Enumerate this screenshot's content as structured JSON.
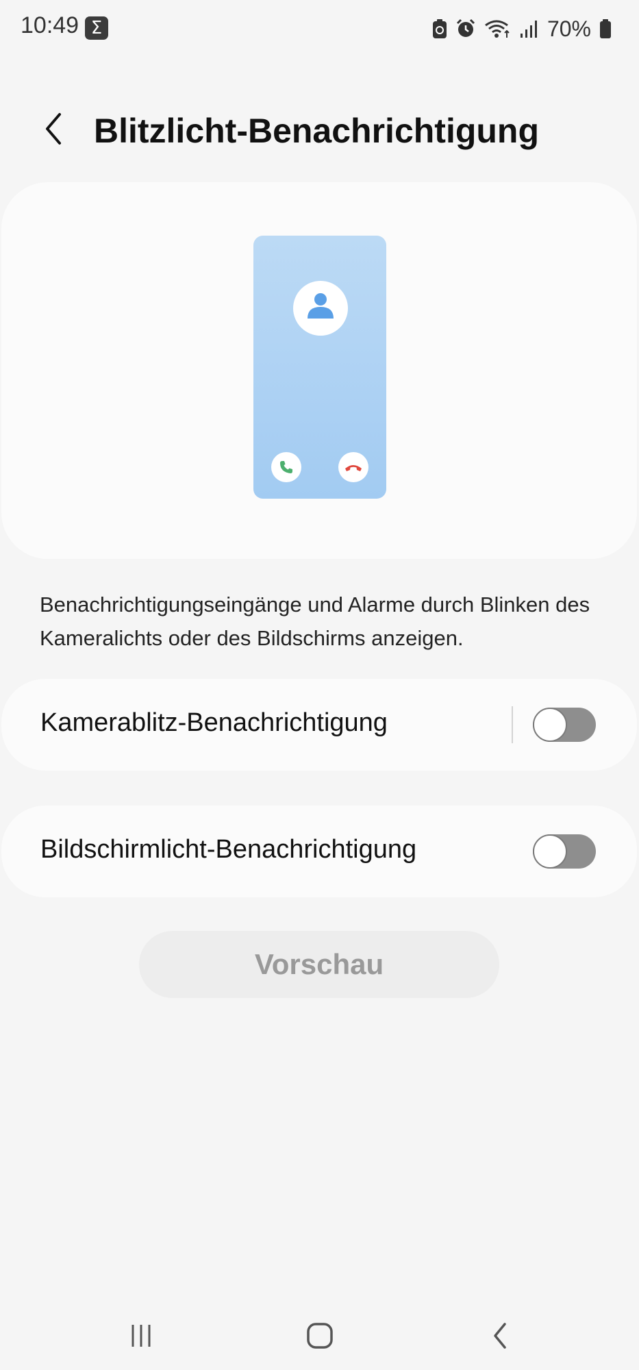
{
  "status_bar": {
    "time": "10:49",
    "notification_icon": "sigma-icon",
    "battery": "70%",
    "icons": [
      "battery-saver-icon",
      "alarm-icon",
      "wifi-icon",
      "signal-icon",
      "battery-icon"
    ]
  },
  "header": {
    "back_icon": "chevron-left-icon",
    "title": "Blitzlicht-Benachrichtigung"
  },
  "illustration": {
    "icons": [
      "person-icon",
      "phone-accept-icon",
      "phone-decline-icon"
    ]
  },
  "description": "Benachrichtigungseingänge und Alarme durch Blinken des Kameralichts oder des Bildschirms anzeigen.",
  "settings": [
    {
      "label": "Kamerablitz-Benachrichtigung",
      "enabled": false,
      "divider": true
    },
    {
      "label": "Bildschirmlicht-Benachrichtigung",
      "enabled": false,
      "divider": false
    }
  ],
  "preview_button": {
    "label": "Vorschau",
    "enabled": false
  },
  "nav_bar": {
    "icons": [
      "recents-icon",
      "home-icon",
      "back-icon"
    ]
  },
  "colors": {
    "background": "#f5f5f5",
    "card": "#fbfbfb",
    "toggle_off": "#8e8e8e",
    "phone_gradient_top": "#bcdaf5",
    "phone_gradient_bottom": "#a2cbf2",
    "accept_green": "#4caf6e",
    "decline_red": "#e0483e",
    "avatar_blue": "#5a9fe6"
  }
}
